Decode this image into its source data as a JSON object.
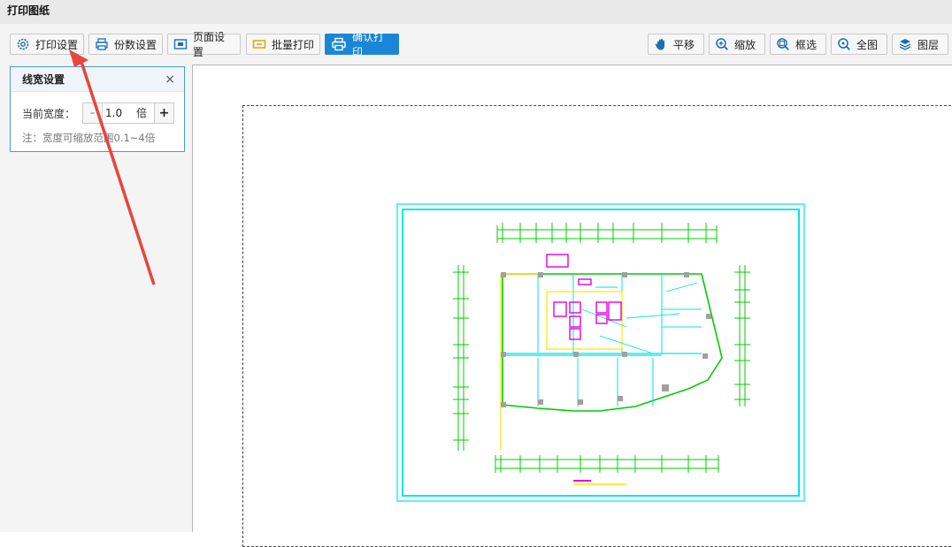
{
  "window": {
    "title": "打印图纸"
  },
  "toolbar": {
    "print_settings": "打印设置",
    "copies_settings": "份数设置",
    "page_settings": "页面设置",
    "batch_print": "批量打印",
    "confirm_print": "确认打印",
    "pan": "平移",
    "zoom": "缩放",
    "box_select": "框选",
    "full_view": "全图",
    "layers": "图层"
  },
  "line_width_panel": {
    "title": "线宽设置",
    "close": "×",
    "current_width_label": "当前宽度：",
    "minus": "-",
    "value": "1.0",
    "unit": "倍",
    "plus": "+",
    "note": "注：宽度可缩放范围0.1~4倍"
  },
  "colors": {
    "primary": "#1a86d8",
    "annotation_arrow": "#e8453c",
    "cad_cyan": "#00e5e5",
    "cad_green": "#00cc00",
    "cad_magenta": "#e000e0",
    "cad_yellow": "#ffe600"
  }
}
